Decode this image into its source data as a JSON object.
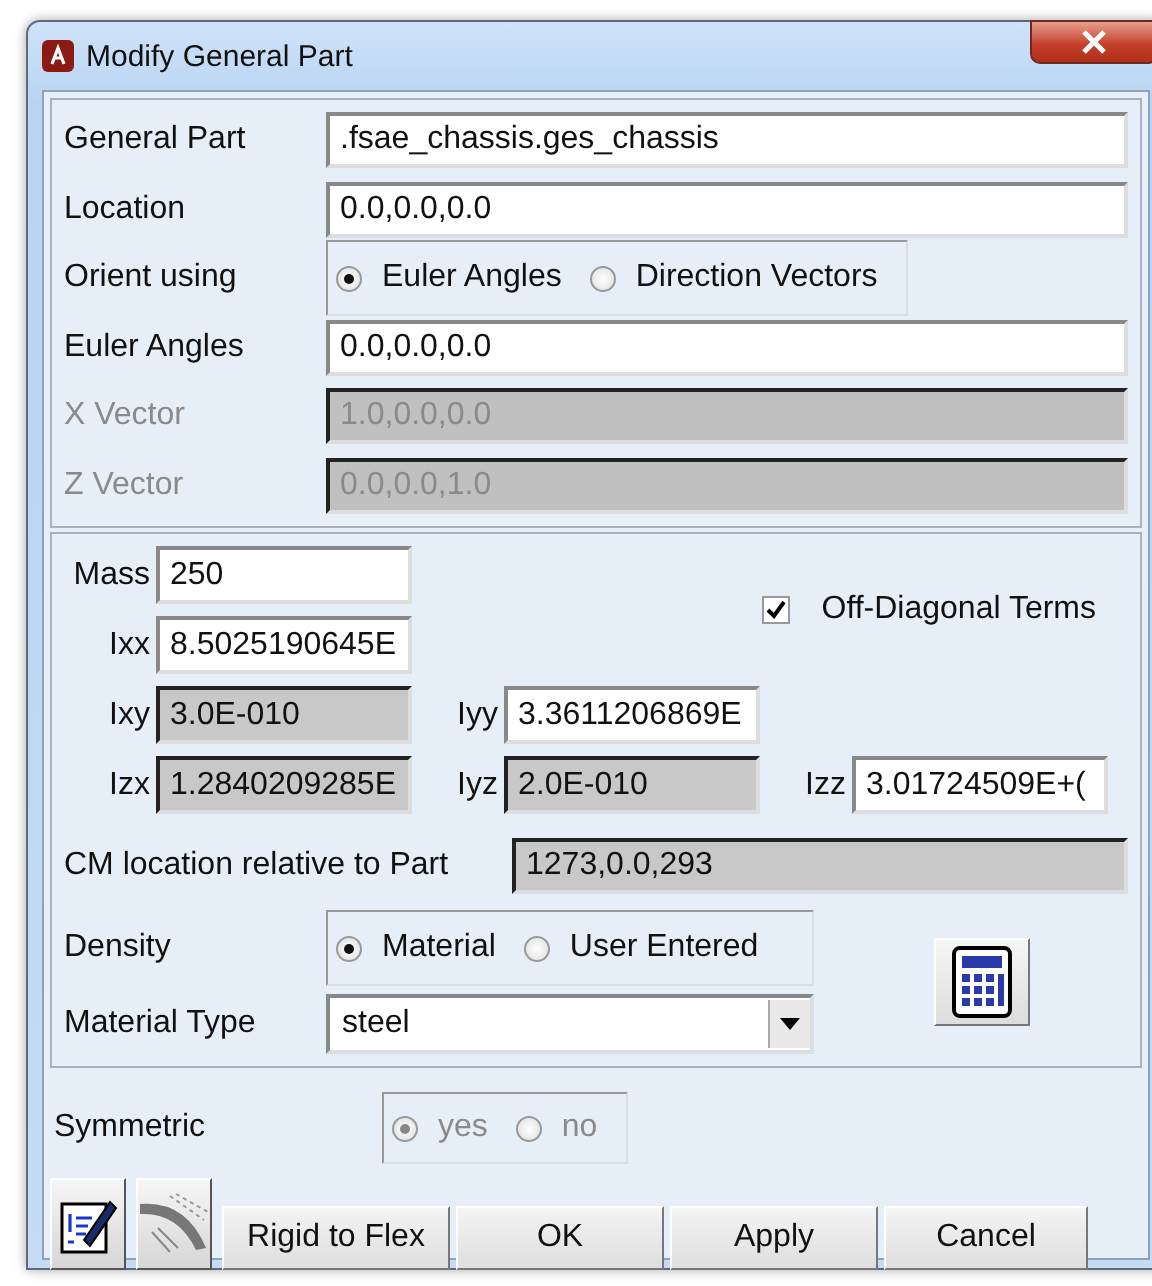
{
  "window": {
    "title": "Modify General Part"
  },
  "top_rows": [
    {
      "kind": "text",
      "label": "General Part",
      "value": ".fsae_chassis.ges_chassis",
      "disabled": false
    },
    {
      "kind": "text",
      "label": "Location",
      "value": "0.0,0.0,0.0",
      "disabled": false
    },
    {
      "kind": "radio",
      "label": "Orient using",
      "options": [
        {
          "label": "Euler Angles",
          "selected": true
        },
        {
          "label": "Direction Vectors",
          "selected": false
        }
      ]
    },
    {
      "kind": "text",
      "label": "Euler Angles",
      "value": "0.0,0.0,0.0",
      "disabled": false
    },
    {
      "kind": "text",
      "label": "X Vector",
      "value": "1.0,0.0,0.0",
      "disabled": true
    },
    {
      "kind": "text",
      "label": "Z Vector",
      "value": "0.0,0.0,1.0",
      "disabled": true
    }
  ],
  "inertia_rows": [
    [
      {
        "label": "Mass",
        "value": "250",
        "disabled": false
      }
    ],
    [
      {
        "label": "Ixx",
        "value": "8.5025190645E",
        "disabled": false
      }
    ],
    [
      {
        "label": "Ixy",
        "value": "3.0E-010",
        "disabled": true
      },
      {
        "label": "Iyy",
        "value": "3.3611206869E",
        "disabled": false
      }
    ],
    [
      {
        "label": "Izx",
        "value": "1.2840209285E",
        "disabled": true
      },
      {
        "label": "Iyz",
        "value": "2.0E-010",
        "disabled": true
      },
      {
        "label": "Izz",
        "value": "3.01724509E+(",
        "disabled": false
      }
    ]
  ],
  "off_diagonal": {
    "label": "Off-Diagonal Terms",
    "checked": true
  },
  "cm_location": {
    "label": "CM location relative to Part",
    "value": "1273,0.0,293",
    "disabled": true
  },
  "density": {
    "label": "Density",
    "options": [
      {
        "label": "Material",
        "selected": true
      },
      {
        "label": "User Entered",
        "selected": false
      }
    ]
  },
  "material_type": {
    "label": "Material Type",
    "value": "steel"
  },
  "symmetric": {
    "label": "Symmetric",
    "disabled": true,
    "options": [
      {
        "label": "yes",
        "selected": true
      },
      {
        "label": "no",
        "selected": false
      }
    ]
  },
  "buttons": [
    "Rigid to Flex",
    "OK",
    "Apply",
    "Cancel"
  ]
}
